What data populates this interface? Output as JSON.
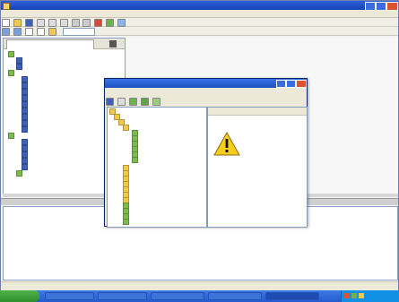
{
  "window": {
    "title": ""
  },
  "menu": [
    "",
    "",
    "",
    "",
    "",
    "",
    "",
    ""
  ],
  "tabs": [
    ""
  ],
  "left_tree": {
    "items": [
      "",
      "",
      "",
      "",
      "",
      "",
      "",
      "",
      "",
      "",
      "",
      "",
      "",
      "",
      "",
      "",
      "",
      "",
      "",
      ""
    ]
  },
  "output": {
    "lines": [
      "",
      "",
      "",
      "",
      "",
      "",
      "",
      "",
      "",
      "",
      "",
      "",
      "",
      "",
      "",
      ""
    ]
  },
  "status": {
    "text": ""
  },
  "dialog": {
    "title": "",
    "menu": [
      "",
      "",
      "",
      ""
    ],
    "tree": [
      "",
      "",
      "",
      "",
      "",
      "",
      "",
      "",
      "",
      "",
      "",
      "",
      "",
      "",
      "",
      "",
      "",
      "",
      "",
      "",
      "",
      ""
    ],
    "message_header": "",
    "message_lines": [
      "",
      ""
    ]
  },
  "taskbar": {
    "start_label": "",
    "tasks": [
      "",
      "",
      "",
      "",
      ""
    ],
    "clock": ""
  }
}
